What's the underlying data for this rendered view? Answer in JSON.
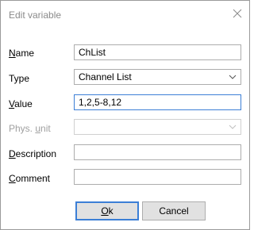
{
  "dialog": {
    "title": "Edit variable"
  },
  "fields": {
    "name": {
      "label_pre": "",
      "label_mnemonic": "N",
      "label_post": "ame",
      "value": "ChList"
    },
    "type": {
      "label": "Type",
      "value": "Channel List"
    },
    "value": {
      "label_pre": "",
      "label_mnemonic": "V",
      "label_post": "alue",
      "value": "1,2,5-8,12"
    },
    "phys_unit": {
      "label_pre": "Phys. ",
      "label_mnemonic": "u",
      "label_post": "nit",
      "value": ""
    },
    "description": {
      "label_pre": "",
      "label_mnemonic": "D",
      "label_post": "escription",
      "value": ""
    },
    "comment": {
      "label_pre": "",
      "label_mnemonic": "C",
      "label_post": "omment",
      "value": ""
    }
  },
  "buttons": {
    "ok": {
      "label_mnemonic": "O",
      "label_post": "k"
    },
    "cancel": {
      "label": "Cancel"
    }
  },
  "icons": {
    "close": "close-icon",
    "dropdown": "chevron-down-icon"
  },
  "colors": {
    "focus_border": "#3c7fd6",
    "disabled_text": "#a0a0a0"
  }
}
